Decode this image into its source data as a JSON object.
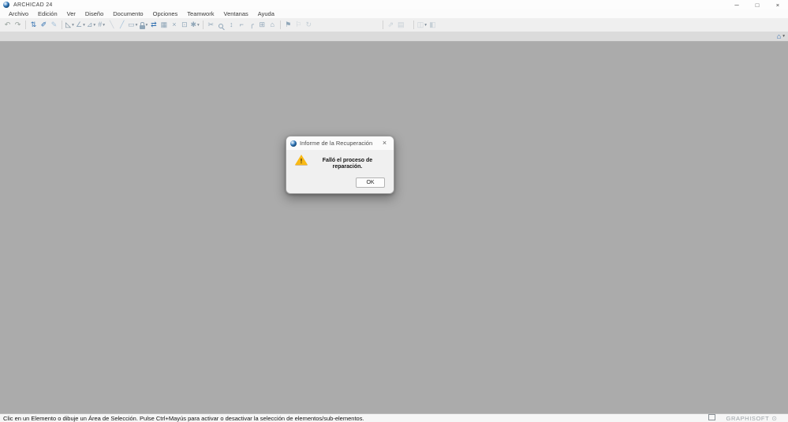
{
  "window": {
    "title": "ARCHICAD 24",
    "controls": {
      "minimize": "─",
      "maximize": "□",
      "close": "×"
    }
  },
  "menubar": {
    "items": [
      "Archivo",
      "Edición",
      "Ver",
      "Diseño",
      "Documento",
      "Opciones",
      "Teamwork",
      "Ventanas",
      "Ayuda"
    ]
  },
  "toolbar": {
    "caret": "▾",
    "groups": [
      {
        "sep_before": false,
        "items": [
          {
            "name": "undo-icon",
            "glyph": "↶",
            "tone": "gray"
          },
          {
            "name": "redo-icon",
            "glyph": "↷",
            "tone": "gray"
          }
        ]
      },
      {
        "sep_before": true,
        "items": [
          {
            "name": "transfer-parameters-icon",
            "glyph": "⇅",
            "tone": "blue"
          },
          {
            "name": "pickup-parameters-eyedropper-icon",
            "glyph": "✐",
            "tone": "blue"
          },
          {
            "name": "inject-parameters-syringe-icon",
            "glyph": "✎",
            "tone": "lightblue"
          }
        ]
      },
      {
        "sep_before": true,
        "items": [
          {
            "name": "select-tool-icon",
            "glyph": "◺",
            "tone": "dark",
            "dropdown": true
          },
          {
            "name": "slope-tool-icon",
            "glyph": "∠",
            "tone": "steel",
            "dropdown": true
          },
          {
            "name": "wall-tool-icon",
            "glyph": "⊿",
            "tone": "steel",
            "dropdown": true
          },
          {
            "name": "grid-snap-icon",
            "glyph": "#",
            "tone": "steel",
            "dropdown": true
          },
          {
            "name": "guide-line-icon",
            "glyph": "╲",
            "tone": "dim"
          },
          {
            "name": "feather-icon",
            "glyph": "╱",
            "tone": "lightblue"
          },
          {
            "name": "marquee-tool-icon",
            "glyph": "▭",
            "tone": "steel",
            "dropdown": true
          },
          {
            "name": "lock-icon",
            "shape": "lock",
            "tone": "steel",
            "dropdown": true
          },
          {
            "name": "renovation-filter-icon",
            "glyph": "⇄",
            "tone": "blue"
          },
          {
            "name": "schedule-icon",
            "glyph": "▦",
            "tone": "steel"
          },
          {
            "name": "close-element-icon",
            "glyph": "×",
            "tone": "steel"
          },
          {
            "name": "stretch-icon",
            "glyph": "⊡",
            "tone": "steel"
          },
          {
            "name": "options-gear-icon",
            "glyph": "✱",
            "tone": "steel",
            "dropdown": true
          }
        ]
      },
      {
        "sep_before": true,
        "items": [
          {
            "name": "trim-scissors-icon",
            "glyph": "✂",
            "tone": "steel"
          },
          {
            "name": "zoom-icon",
            "shape": "zoom",
            "tone": "steel"
          },
          {
            "name": "measure-icon",
            "glyph": "↕",
            "tone": "steel"
          },
          {
            "name": "corner-icon",
            "glyph": "⌐",
            "tone": "steel"
          },
          {
            "name": "fillet-icon",
            "glyph": "╭",
            "tone": "steel"
          },
          {
            "name": "resize-icon",
            "glyph": "⊞",
            "tone": "steel"
          },
          {
            "name": "roof-icon",
            "glyph": "⌂",
            "tone": "steel"
          }
        ]
      },
      {
        "sep_before": true,
        "items": [
          {
            "name": "flag-icon",
            "glyph": "⚑",
            "tone": "steel"
          },
          {
            "name": "flag-outline-icon",
            "glyph": "⚐",
            "tone": "dim"
          },
          {
            "name": "refresh-icon",
            "glyph": "↻",
            "tone": "dim"
          }
        ]
      },
      {
        "sep_before": true,
        "gap_before": 84,
        "items": [
          {
            "name": "open-in-new-icon",
            "glyph": "⇗",
            "tone": "dim"
          },
          {
            "name": "layers-icon",
            "glyph": "▤",
            "tone": "dim"
          }
        ]
      },
      {
        "sep_before": true,
        "gap_before": 6,
        "items": [
          {
            "name": "panel-layout-icon",
            "glyph": "◫",
            "tone": "dim",
            "dropdown": true
          },
          {
            "name": "panel-save-icon",
            "glyph": "◧",
            "tone": "dim"
          }
        ]
      }
    ]
  },
  "tabbar": {
    "overview_glyph": "⌂",
    "caret": "▾"
  },
  "dialog": {
    "title": "Informe de la Recuperación",
    "close_glyph": "×",
    "warning_glyph": "!",
    "message": "Falló el proceso de reparación.",
    "ok_label": "OK"
  },
  "statusbar": {
    "hint": "Clic en un Elemento o dibuje un Área de Selección. Pulse Ctrl+Mayús para activar o desactivar la selección de elementos/sub-elementos.",
    "brand": "GRAPHISOFT",
    "brand_logo": "⊙"
  },
  "colors": {
    "accent_blue": "#2f6fb0",
    "canvas_gray": "#ababab",
    "warning_yellow": "#f9b915"
  }
}
